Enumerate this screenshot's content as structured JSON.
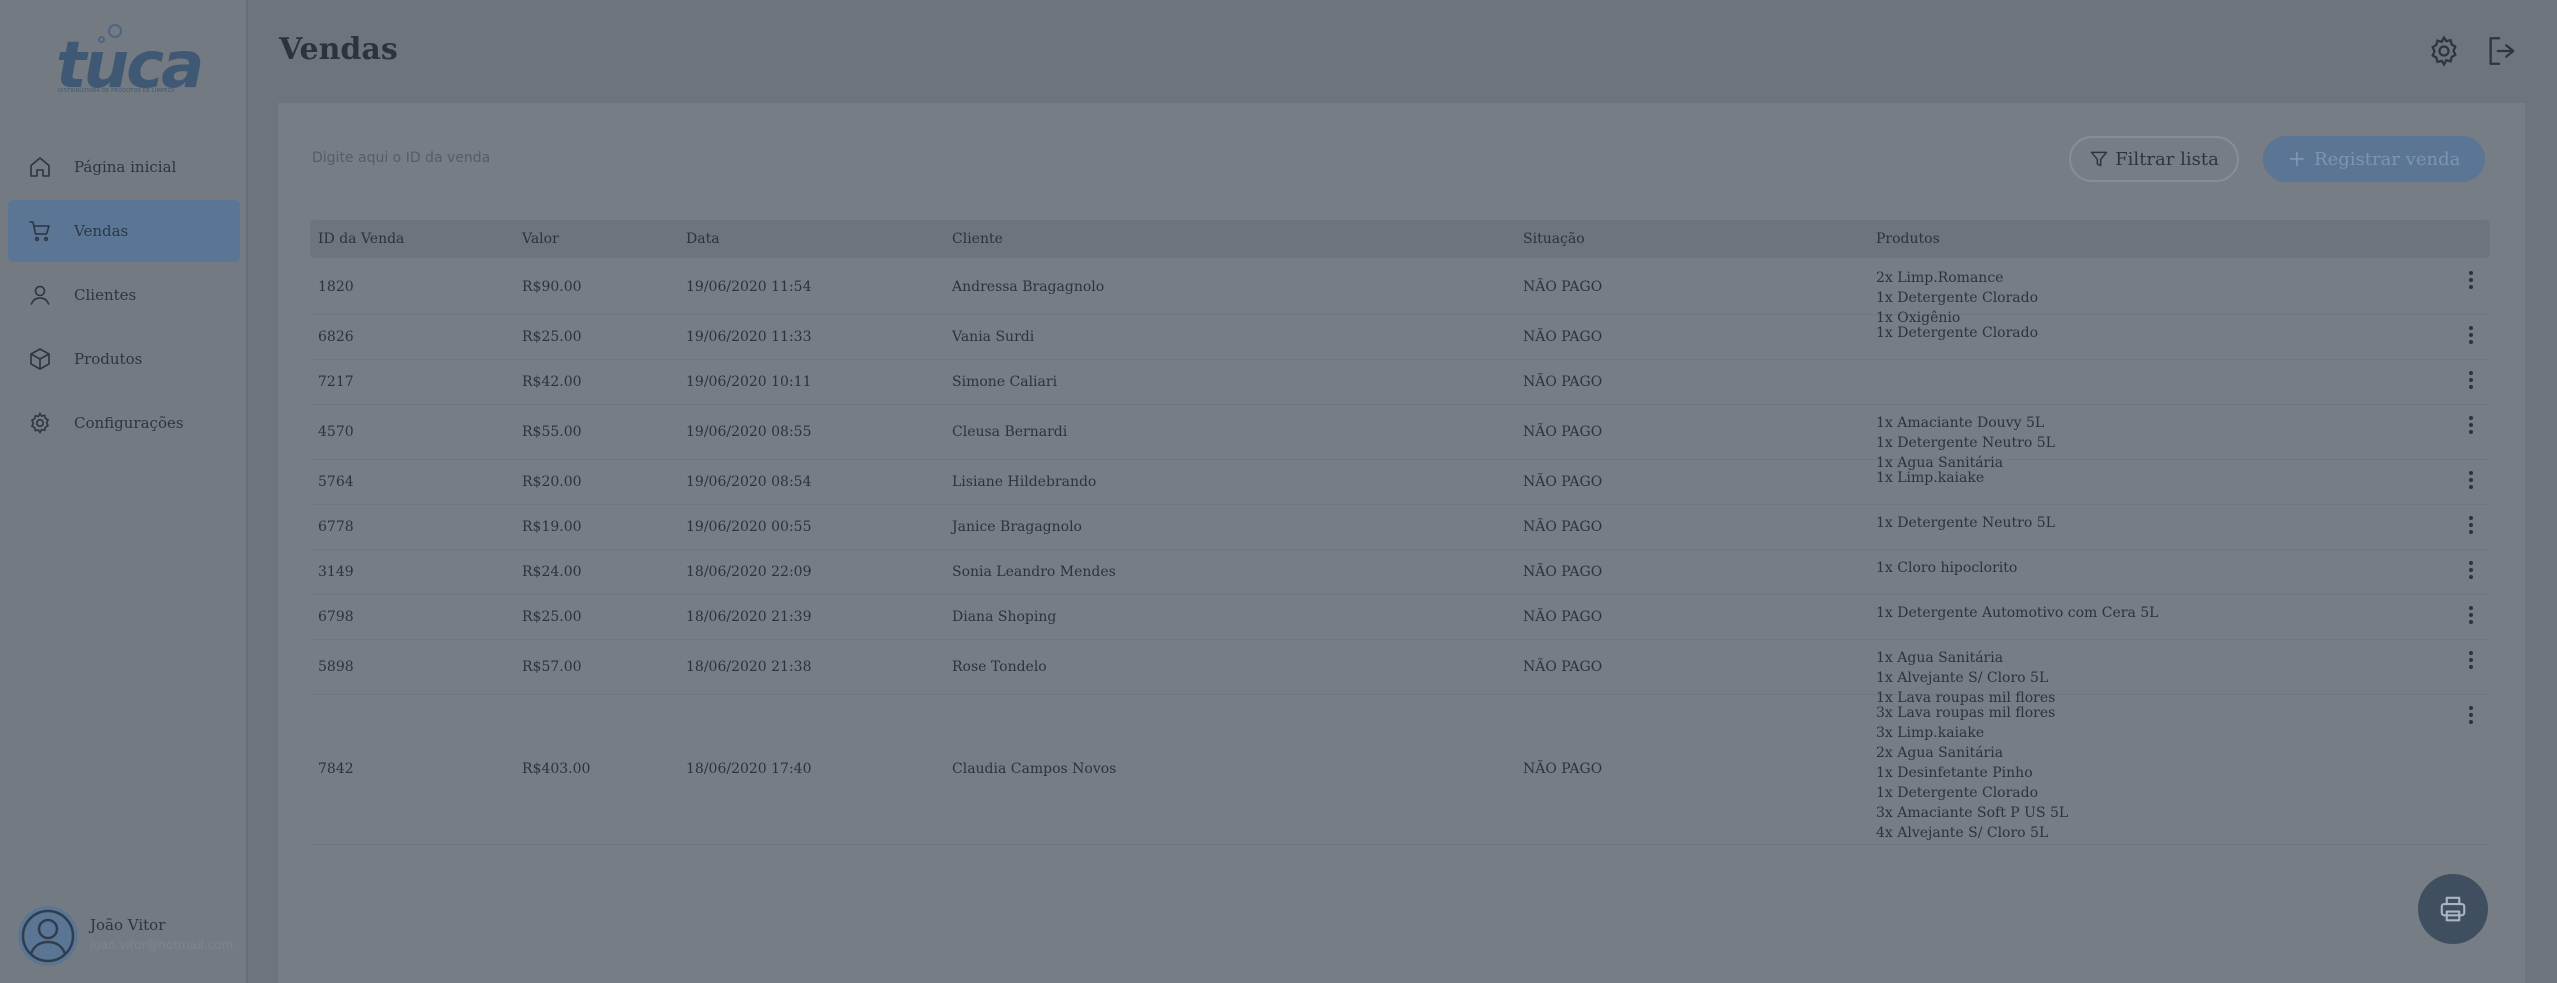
{
  "brand": {
    "logo_text": "tuca",
    "logo_subtitle": "DISTRIBUIDORA DE PRODUTOS DE LIMPEZA"
  },
  "sidebar": {
    "items": [
      {
        "label": "Página inicial",
        "icon": "home-icon",
        "active": false
      },
      {
        "label": "Vendas",
        "icon": "cart-icon",
        "active": true
      },
      {
        "label": "Clientes",
        "icon": "user-icon",
        "active": false
      },
      {
        "label": "Produtos",
        "icon": "box-icon",
        "active": false
      },
      {
        "label": "Configurações",
        "icon": "gear-icon",
        "active": false
      }
    ],
    "user": {
      "name": "João Vitor",
      "email": "joao.vitor@hotmail.com"
    }
  },
  "header": {
    "title": "Vendas",
    "settings_icon": "gear-icon",
    "logout_icon": "logout-icon"
  },
  "toolbar": {
    "search_placeholder": "Digite aqui o ID da venda",
    "filter_label": "Filtrar lista",
    "register_label": "Registrar venda",
    "register_icon": "plus-icon"
  },
  "table": {
    "columns": [
      "ID da Venda",
      "Valor",
      "Data",
      "Cliente",
      "Situação",
      "Produtos"
    ],
    "rows": [
      {
        "id": "1820",
        "valor": "R$90.00",
        "data": "19/06/2020 11:54",
        "cliente": "Andressa Bragagnolo",
        "situacao": "NÃO PAGO",
        "produtos": [
          "2x Limp.Romance",
          "1x Detergente Clorado",
          "1x Oxigênio"
        ]
      },
      {
        "id": "6826",
        "valor": "R$25.00",
        "data": "19/06/2020 11:33",
        "cliente": "Vania Surdi",
        "situacao": "NÃO PAGO",
        "produtos": [
          "1x Detergente Clorado"
        ]
      },
      {
        "id": "7217",
        "valor": "R$42.00",
        "data": "19/06/2020 10:11",
        "cliente": "Simone Caliari",
        "situacao": "NÃO PAGO",
        "produtos": []
      },
      {
        "id": "4570",
        "valor": "R$55.00",
        "data": "19/06/2020 08:55",
        "cliente": "Cleusa Bernardi",
        "situacao": "NÃO PAGO",
        "produtos": [
          "1x Amaciante Douvy 5L",
          "1x Detergente Neutro 5L",
          "1x Agua Sanitária"
        ]
      },
      {
        "id": "5764",
        "valor": "R$20.00",
        "data": "19/06/2020 08:54",
        "cliente": "Lisiane Hildebrando",
        "situacao": "NÃO PAGO",
        "produtos": [
          "1x Limp.kaiake"
        ]
      },
      {
        "id": "6778",
        "valor": "R$19.00",
        "data": "19/06/2020 00:55",
        "cliente": "Janice Bragagnolo",
        "situacao": "NÃO PAGO",
        "produtos": [
          "1x Detergente Neutro 5L"
        ]
      },
      {
        "id": "3149",
        "valor": "R$24.00",
        "data": "18/06/2020 22:09",
        "cliente": "Sonia Leandro Mendes",
        "situacao": "NÃO PAGO",
        "produtos": [
          "1x Cloro hipoclorito"
        ]
      },
      {
        "id": "6798",
        "valor": "R$25.00",
        "data": "18/06/2020 21:39",
        "cliente": "Diana Shoping",
        "situacao": "NÃO PAGO",
        "produtos": [
          "1x Detergente Automotivo com Cera 5L"
        ]
      },
      {
        "id": "5898",
        "valor": "R$57.00",
        "data": "18/06/2020 21:38",
        "cliente": "Rose Tondelo",
        "situacao": "NÃO PAGO",
        "produtos": [
          "1x Agua Sanitária",
          "1x Alvejante S/ Cloro 5L",
          "1x Lava roupas mil flores"
        ]
      },
      {
        "id": "7842",
        "valor": "R$403.00",
        "data": "18/06/2020 17:40",
        "cliente": "Claudia Campos Novos",
        "situacao": "NÃO PAGO",
        "produtos": [
          "3x Lava roupas mil flores",
          "3x Limp.kaiake",
          "2x Agua Sanitária",
          "1x Desinfetante Pinho",
          "1x Detergente Clorado",
          "3x Amaciante Soft P US 5L",
          "4x Alvejante S/ Cloro 5L"
        ]
      }
    ]
  },
  "fab": {
    "icon": "printer-icon"
  },
  "colors": {
    "accent": "#5b7594",
    "overlay_bg": "#6d747d",
    "fab": "#3f4f60"
  }
}
